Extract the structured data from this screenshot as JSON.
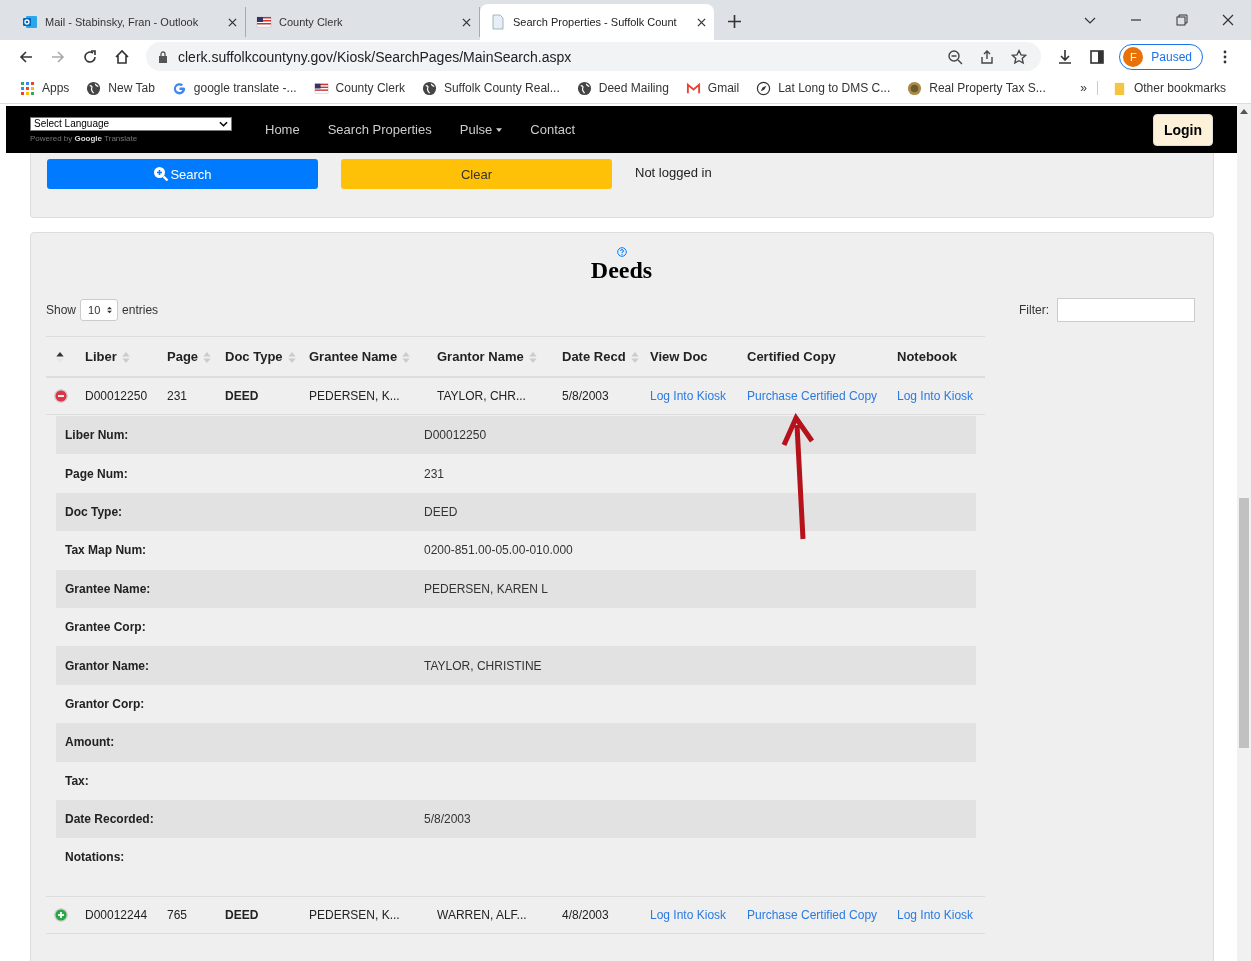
{
  "browser": {
    "tabs": [
      {
        "title": "Mail - Stabinsky, Fran - Outlook",
        "selected": false
      },
      {
        "title": "County Clerk",
        "selected": false
      },
      {
        "title": "Search Properties - Suffolk Count",
        "selected": true
      }
    ],
    "address": "clerk.suffolkcountyny.gov/Kiosk/SearchPages/MainSearch.aspx",
    "profile": {
      "initial": "F",
      "label": "Paused"
    },
    "bookmarks": [
      {
        "label": "Apps"
      },
      {
        "label": "New Tab"
      },
      {
        "label": "google translate -..."
      },
      {
        "label": "County Clerk"
      },
      {
        "label": "Suffolk County Real..."
      },
      {
        "label": "Deed Mailing"
      },
      {
        "label": "Gmail"
      },
      {
        "label": "Lat Long to DMS C..."
      },
      {
        "label": "Real Property Tax S..."
      }
    ],
    "more": "»",
    "other_bookmarks": "Other bookmarks"
  },
  "navbar": {
    "language_select": "Select Language",
    "powered_by": "Powered by",
    "google": "Google",
    "translate": "Translate",
    "links": [
      {
        "label": "Home",
        "has_menu": false
      },
      {
        "label": "Search Properties",
        "has_menu": false
      },
      {
        "label": "Pulse",
        "has_menu": true
      },
      {
        "label": "Contact",
        "has_menu": false
      }
    ],
    "login": "Login"
  },
  "search_panel": {
    "search": "Search",
    "clear": "Clear",
    "status": "Not logged in"
  },
  "deeds": {
    "title": "Deeds",
    "show": "Show",
    "page_size": "10",
    "entries": "entries",
    "filter": "Filter:",
    "columns": [
      {
        "sortable": true,
        "sorted": true
      },
      {
        "label": "Liber",
        "sortable": true,
        "sorted": false
      },
      {
        "label": "Page",
        "sortable": true,
        "sorted": false
      },
      {
        "label": "Doc Type",
        "sortable": true,
        "sorted": false
      },
      {
        "label": "Grantee Name",
        "sortable": true,
        "sorted": false
      },
      {
        "label": "Grantor Name",
        "sortable": true,
        "sorted": false
      },
      {
        "label": "Date Recd",
        "sortable": true,
        "sorted": false
      },
      {
        "label": "View Doc",
        "sortable": false
      },
      {
        "label": "Certified Copy",
        "sortable": false
      },
      {
        "label": "Notebook",
        "sortable": false
      }
    ],
    "rows": [
      {
        "expanded": true,
        "liber": "D00012250",
        "page": "231",
        "doc_type": "DEED",
        "grantee": "PEDERSEN, K...",
        "grantor": "TAYLOR, CHR...",
        "date": "5/8/2003",
        "view_doc": "Log Into Kiosk",
        "certified": "Purchase Certified Copy",
        "notebook": "Log Into Kiosk",
        "details": [
          {
            "label": "Liber Num:",
            "value": "D00012250"
          },
          {
            "label": "Page Num:",
            "value": "231"
          },
          {
            "label": "Doc Type:",
            "value": "DEED"
          },
          {
            "label": "Tax Map Num:",
            "value": "0200-851.00-05.00-010.000"
          },
          {
            "label": "Grantee Name:",
            "value": "PEDERSEN, KAREN L"
          },
          {
            "label": "Grantee Corp:"
          },
          {
            "label": "Grantor Name:",
            "value": "TAYLOR, CHRISTINE"
          },
          {
            "label": "Grantor Corp:"
          },
          {
            "label": "Amount:"
          },
          {
            "label": "Tax:"
          },
          {
            "label": "Date Recorded:",
            "value": "5/8/2003"
          },
          {
            "label": "Notations:"
          }
        ]
      },
      {
        "expanded": false,
        "liber": "D00012244",
        "page": "765",
        "doc_type": "DEED",
        "grantee": "PEDERSEN, K...",
        "grantor": "WARREN, ALF...",
        "date": "4/8/2003",
        "view_doc": "Log Into Kiosk",
        "certified": "Purchase Certified Copy",
        "notebook": "Log Into Kiosk"
      }
    ]
  }
}
